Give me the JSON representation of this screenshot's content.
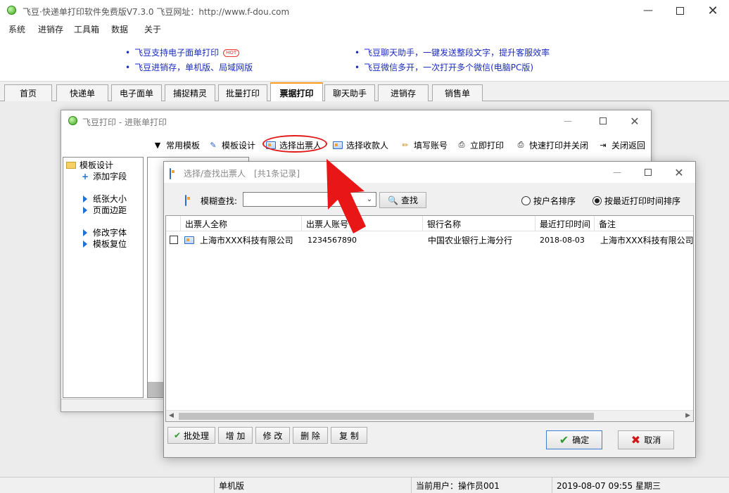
{
  "main": {
    "title": "飞豆·快递单打印软件免费版V7.3.0  飞豆网址：http://www.f-dou.com",
    "menu": [
      "系统",
      "进销存",
      "工具箱",
      "数据",
      "关于"
    ],
    "ads": [
      "飞豆支持电子面单打印",
      "飞豆进销存，单机版、局域网版",
      "飞豆聊天助手，一键发送整段文字，提升客服效率",
      "飞豆微信多开，一次打开多个微信(电脑PC版)"
    ],
    "hot_badge": "HOT",
    "tabs": [
      "首页",
      "快递单",
      "电子面单",
      "捕捉精灵",
      "批量打印",
      "票据打印",
      "聊天助手",
      "进销存",
      "销售单"
    ],
    "active_tab": "票据打印",
    "status": {
      "mode": "单机版",
      "user": "当前用户：操作员001",
      "datetime": "2019-08-07 09:55 星期三"
    }
  },
  "window1": {
    "title": "飞豆打印 - 进账单打印",
    "toolbar": [
      "常用模板",
      "模板设计",
      "选择出票人",
      "选择收款人",
      "填写账号",
      "立即打印",
      "快速打印并关闭",
      "关闭返回"
    ],
    "tree": {
      "root": "模板设计",
      "items": [
        "添加字段",
        "纸张大小",
        "页面边距",
        "修改字体",
        "模板复位"
      ]
    }
  },
  "dialog": {
    "title": "选择/查找出票人",
    "record_count": "[共1条记录]",
    "search_label": "模糊查找:",
    "search_value": "",
    "find_button": "查找",
    "sort_options": [
      "按户名排序",
      "按最近打印时间排序"
    ],
    "sort_selected": "按最近打印时间排序",
    "columns": [
      "出票人全称",
      "出票人账号",
      "银行名称",
      "最近打印时间",
      "备注"
    ],
    "rows": [
      {
        "name": "上海市XXX科技有限公司",
        "account": "1234567890",
        "bank": "中国农业银行上海分行",
        "last_print": "2018-08-03",
        "note": "上海市XXX科技有限公司"
      }
    ],
    "action_buttons": [
      "批处理",
      "增 加",
      "修 改",
      "删 除",
      "复 制"
    ],
    "ok_button": "确定",
    "cancel_button": "取消"
  },
  "colors": {
    "link": "#1b2cc0",
    "active_tab_accent": "#ff9a1a",
    "annotation": "#e31a1a",
    "ok_check": "#2f9a2f",
    "cancel_x": "#d01818"
  },
  "icons": [
    "app-icon",
    "minimize-icon",
    "maximize-icon",
    "close-icon",
    "dropdown-triangle-icon",
    "template-design-icon",
    "payer-card-icon",
    "payee-card-icon",
    "pencil-icon",
    "printer-icon",
    "fast-print-icon",
    "exit-icon",
    "folder-icon",
    "plus-icon",
    "tree-arrow-icon",
    "search-magnifier-icon",
    "check-icon",
    "cancel-x-icon",
    "red-arrow-annotation"
  ]
}
